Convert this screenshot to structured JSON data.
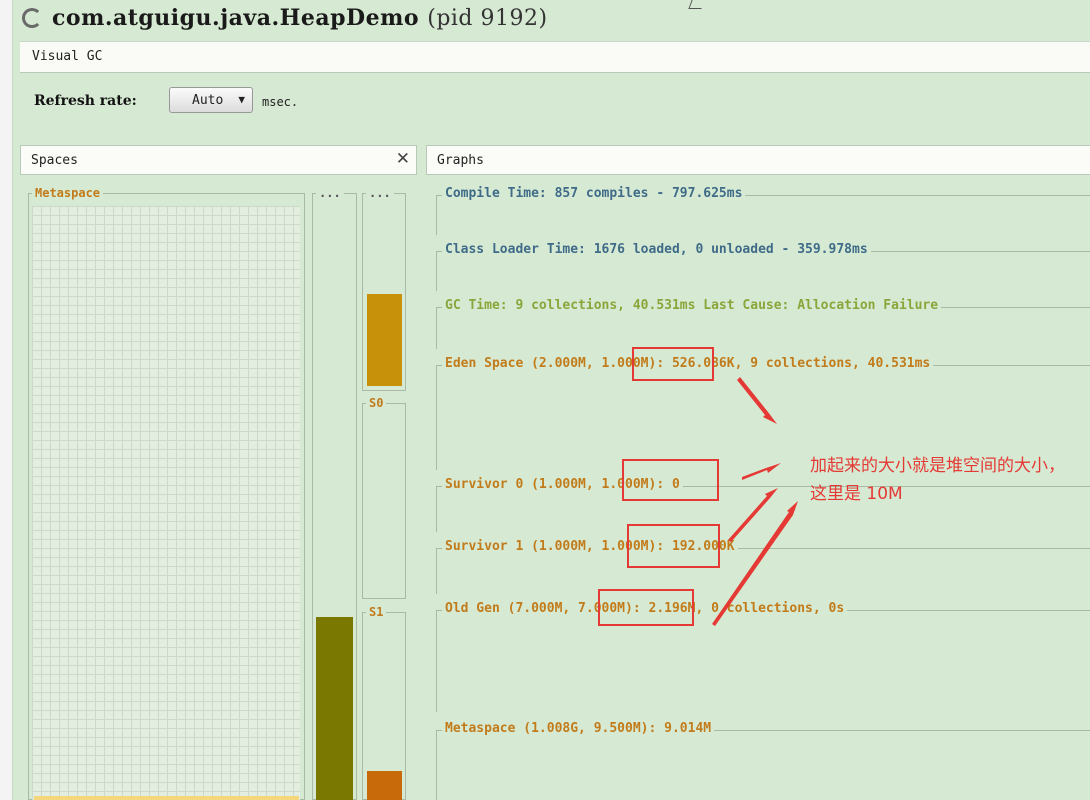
{
  "window": {
    "app_name": "com.atguigu.java.HeapDemo",
    "pid_text": "(pid 9192)"
  },
  "tab": {
    "label": "Visual GC"
  },
  "refresh": {
    "label": "Refresh rate:",
    "value": "Auto",
    "unit": "msec."
  },
  "spaces_panel": {
    "title": "Spaces",
    "metaspace_label": "Metaspace",
    "col1_label": "...",
    "col2_label": "...",
    "s0_label": "S0",
    "s1_label": "S1"
  },
  "graphs_panel": {
    "title": "Graphs",
    "compile_time": "Compile Time: 857 compiles - 797.625ms",
    "class_loader_time": "Class Loader Time: 1676 loaded, 0 unloaded - 359.978ms",
    "gc_time": "GC Time: 9 collections, 40.531ms Last Cause: Allocation Failure",
    "eden_space": "Eden Space (2.000M, 1.000M): 526.086K, 9 collections, 40.531ms",
    "survivor_0": "Survivor 0 (1.000M, 1.000M): 0",
    "survivor_1": "Survivor 1 (1.000M, 1.000M): 192.000K",
    "old_gen": "Old Gen (7.000M, 7.000M): 2.196M, 0 collections, 0s",
    "metaspace": "Metaspace (1.008G, 9.500M): 9.014M"
  },
  "annotation": {
    "text": "加起来的大小就是堆空间的大小，这里是 10M"
  },
  "colors": {
    "background": "#d6ead3",
    "old_gen_bar": "#7a7800",
    "eden_bar": "#c8910a",
    "survivor_bar": "#c96a0a",
    "annotation": "#e53935"
  },
  "icons": {
    "loading": "spinner-icon",
    "close": "close-icon",
    "dropdown": "chevron-down-icon"
  }
}
